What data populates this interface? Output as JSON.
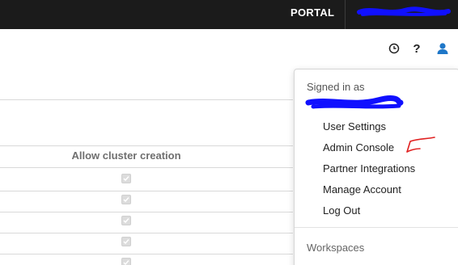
{
  "topbar": {
    "portal_label": "PORTAL"
  },
  "header_icons": [
    "clock-icon",
    "help-icon",
    "user-icon"
  ],
  "header": {
    "help_glyph": "?"
  },
  "table": {
    "column_header": "Allow cluster creation",
    "rows": [
      {
        "checked": true
      },
      {
        "checked": true
      },
      {
        "checked": true
      },
      {
        "checked": true
      },
      {
        "checked": true
      }
    ]
  },
  "user_menu": {
    "signed_in_label": "Signed in as",
    "items": [
      {
        "label": "User Settings"
      },
      {
        "label": "Admin Console"
      },
      {
        "label": "Partner Integrations"
      },
      {
        "label": "Manage Account"
      },
      {
        "label": "Log Out"
      }
    ],
    "workspaces_label": "Workspaces"
  },
  "colors": {
    "topbar_bg": "#1b1b1b",
    "user_icon": "#1f77c8",
    "redaction": "#1010ff",
    "annotation": "#e02020"
  }
}
